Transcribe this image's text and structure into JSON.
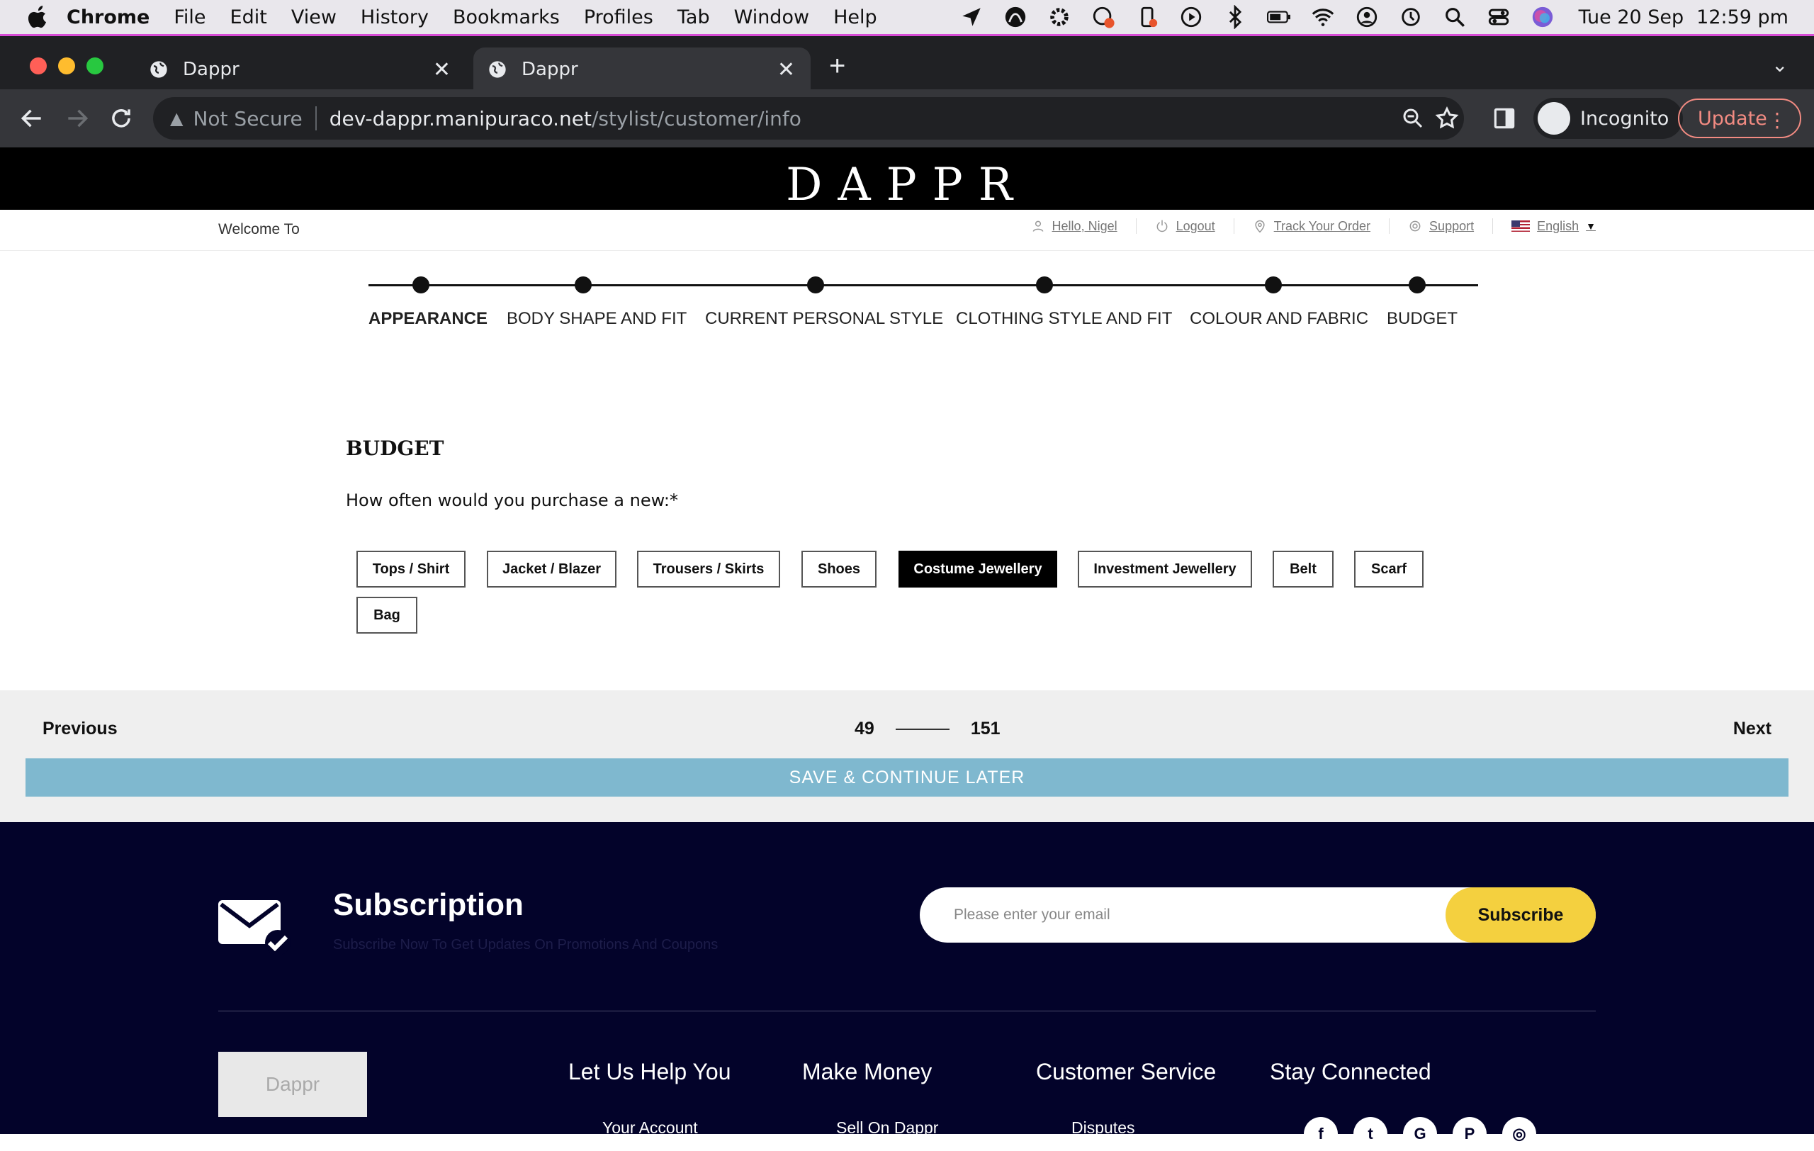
{
  "os": {
    "menu": [
      "Chrome",
      "File",
      "Edit",
      "View",
      "History",
      "Bookmarks",
      "Profiles",
      "Tab",
      "Window",
      "Help"
    ],
    "date": "Tue 20 Sep",
    "time": "12:59 pm"
  },
  "browser": {
    "tabs": [
      {
        "title": "Dappr"
      },
      {
        "title": "Dappr"
      }
    ],
    "security_label": "Not Secure",
    "url_host": "dev-dappr.manipuraco.net",
    "url_path": "/stylist/customer/info",
    "profile_label": "Incognito",
    "update_label": "Update"
  },
  "site": {
    "logo": "DAPPR",
    "welcome": "Welcome To",
    "user_links": {
      "hello": "Hello, Nigel",
      "logout": "Logout",
      "track": "Track Your Order",
      "support": "Support",
      "language": "English"
    }
  },
  "steps": [
    {
      "label": "APPEARANCE",
      "current": true
    },
    {
      "label": "BODY SHAPE AND FIT",
      "current": false
    },
    {
      "label": "CURRENT PERSONAL STYLE",
      "current": false
    },
    {
      "label": "CLOTHING STYLE AND FIT",
      "current": false
    },
    {
      "label": "COLOUR AND FABRIC",
      "current": false
    },
    {
      "label": "BUDGET",
      "current": false
    }
  ],
  "question": {
    "section": "BUDGET",
    "text": "How often would you purchase a new:*",
    "options": [
      {
        "label": "Tops / Shirt",
        "selected": false
      },
      {
        "label": "Jacket / Blazer",
        "selected": false
      },
      {
        "label": "Trousers / Skirts",
        "selected": false
      },
      {
        "label": "Shoes",
        "selected": false
      },
      {
        "label": "Costume Jewellery",
        "selected": true
      },
      {
        "label": "Investment Jewellery",
        "selected": false
      },
      {
        "label": "Belt",
        "selected": false
      },
      {
        "label": "Scarf",
        "selected": false
      },
      {
        "label": "Bag",
        "selected": false
      }
    ]
  },
  "pager": {
    "previous": "Previous",
    "next": "Next",
    "current": "49",
    "total": "151",
    "save_later": "SAVE & CONTINUE LATER"
  },
  "footer": {
    "subscription_title": "Subscription",
    "subscription_desc": "Subscribe Now To Get Updates On Promotions And Coupons",
    "email_placeholder": "Please enter your email",
    "subscribe_label": "Subscribe",
    "logo_text": "Dappr",
    "columns": [
      {
        "heading": "Let Us Help You",
        "first_item": "Your Account"
      },
      {
        "heading": "Make Money",
        "first_item": "Sell On Dappr"
      },
      {
        "heading": "Customer Service",
        "first_item": "Disputes"
      },
      {
        "heading": "Stay Connected",
        "first_item": ""
      }
    ],
    "social": [
      "facebook-icon",
      "twitter-icon",
      "google-icon",
      "pinterest-icon",
      "instagram-icon"
    ]
  },
  "colors": {
    "save_bar": "#7fb8cf",
    "subscribe_btn": "#f4d03f",
    "footer_bg": "#03032a"
  }
}
